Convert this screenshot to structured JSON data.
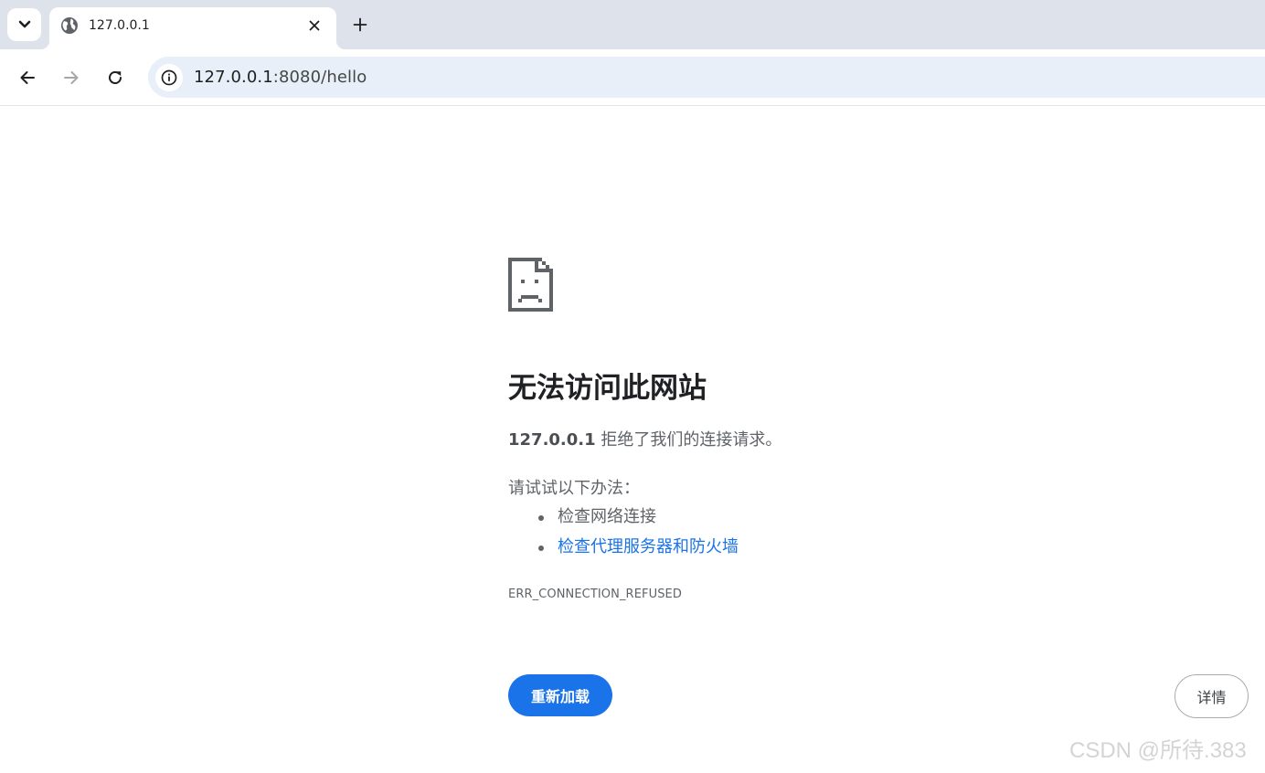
{
  "tab": {
    "title": "127.0.0.1",
    "favicon": "globe-icon",
    "close_icon": "close-icon"
  },
  "tabstrip": {
    "search_icon": "chevron-down-icon",
    "new_tab_icon": "plus-icon"
  },
  "toolbar": {
    "back_icon": "arrow-left-icon",
    "forward_icon": "arrow-right-icon",
    "reload_icon": "reload-icon",
    "site_info_icon": "info-icon",
    "url_host": "127.0.0.1",
    "url_path": ":8080/hello"
  },
  "error": {
    "icon": "sad-page-icon",
    "title": "无法访问此网站",
    "host": "127.0.0.1",
    "message": " 拒绝了我们的连接请求。",
    "suggestions_heading": "请试试以下办法：",
    "suggestions": [
      {
        "label": "检查网络连接",
        "link": false
      },
      {
        "label": "检查代理服务器和防火墙",
        "link": true
      }
    ],
    "code": "ERR_CONNECTION_REFUSED",
    "reload_label": "重新加载",
    "details_label": "详情"
  },
  "watermark": "CSDN @所待.383",
  "colors": {
    "accent": "#1a73e8",
    "tabstrip": "#dee3eb",
    "omnibox": "#e9eff8",
    "text_secondary": "#5f6368"
  }
}
